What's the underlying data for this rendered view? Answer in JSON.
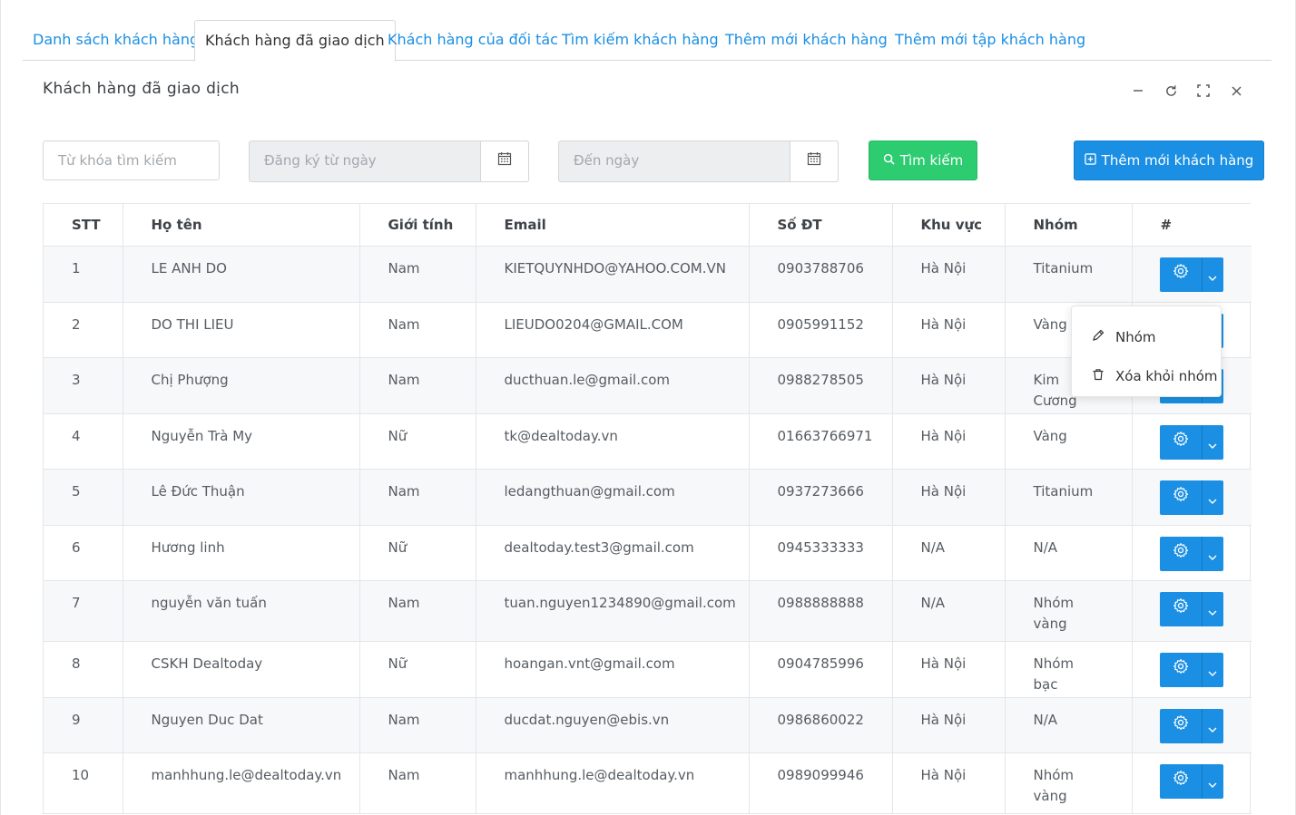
{
  "tabs": [
    {
      "label": "Danh sách khách hàng"
    },
    {
      "label": "Khách hàng đã giao dịch"
    },
    {
      "label": "Khách hàng của đối tác"
    },
    {
      "label": "Tìm kiếm khách hàng"
    },
    {
      "label": "Thêm mới khách hàng"
    },
    {
      "label": "Thêm mới tập khách hàng"
    }
  ],
  "panel": {
    "title": "Khách hàng đã giao dịch",
    "tools": [
      "minimize-icon",
      "refresh-icon",
      "fullscreen-icon",
      "close-icon"
    ]
  },
  "filters": {
    "keyword_placeholder": "Từ khóa tìm kiếm",
    "from_date_placeholder": "Đăng ký từ ngày",
    "to_date_placeholder": "Đến ngày",
    "search_label": "Tìm kiếm",
    "add_label": "Thêm mới khách hàng"
  },
  "table": {
    "headers": [
      "STT",
      "Họ tên",
      "Giới tính",
      "Email",
      "Số ĐT",
      "Khu vực",
      "Nhóm",
      "#"
    ],
    "rows": [
      {
        "stt": "1",
        "name": "LE ANH DO",
        "gender": "Nam",
        "email": "KIETQUYNHDO@YAHOO.COM.VN",
        "phone": "0903788706",
        "region": "Hà Nội",
        "group": "Titanium"
      },
      {
        "stt": "2",
        "name": "DO THI LIEU",
        "gender": "Nam",
        "email": "LIEUDO0204@GMAIL.COM",
        "phone": "0905991152",
        "region": "Hà Nội",
        "group": "Vàng"
      },
      {
        "stt": "3",
        "name": "Chị Phượng",
        "gender": "Nam",
        "email": "ducthuan.le@gmail.com",
        "phone": "0988278505",
        "region": "Hà Nội",
        "group": "Kim Cương"
      },
      {
        "stt": "4",
        "name": "Nguyễn Trà My",
        "gender": "Nữ",
        "email": "tk@dealtoday.vn",
        "phone": "01663766971",
        "region": "Hà Nội",
        "group": "Vàng"
      },
      {
        "stt": "5",
        "name": "Lê Đức Thuận",
        "gender": "Nam",
        "email": "ledangthuan@gmail.com",
        "phone": "0937273666",
        "region": "Hà Nội",
        "group": "Titanium"
      },
      {
        "stt": "6",
        "name": "Hương linh",
        "gender": "Nữ",
        "email": "dealtoday.test3@gmail.com",
        "phone": "0945333333",
        "region": "N/A",
        "group": "N/A"
      },
      {
        "stt": "7",
        "name": "nguyễn văn tuấn",
        "gender": "Nam",
        "email": "tuan.nguyen1234890@gmail.com",
        "phone": "0988888888",
        "region": "N/A",
        "group": "Nhóm vàng"
      },
      {
        "stt": "8",
        "name": "CSKH Dealtoday",
        "gender": "Nữ",
        "email": "hoangan.vnt@gmail.com",
        "phone": "0904785996",
        "region": "Hà Nội",
        "group": "Nhóm bạc"
      },
      {
        "stt": "9",
        "name": "Nguyen Duc Dat",
        "gender": "Nam",
        "email": "ducdat.nguyen@ebis.vn",
        "phone": "0986860022",
        "region": "Hà Nội",
        "group": "N/A"
      },
      {
        "stt": "10",
        "name": "manhhung.le@dealtoday.vn",
        "gender": "Nam",
        "email": "manhhung.le@dealtoday.vn",
        "phone": "0989099946",
        "region": "Hà Nội",
        "group": "Nhóm vàng"
      }
    ]
  },
  "dropdown": {
    "items": [
      {
        "label": "Nhóm",
        "icon": "pencil-icon"
      },
      {
        "label": "Xóa khỏi nhóm",
        "icon": "trash-icon"
      }
    ]
  },
  "colors": {
    "primary": "#1a8fe3",
    "success": "#2dcc70"
  }
}
